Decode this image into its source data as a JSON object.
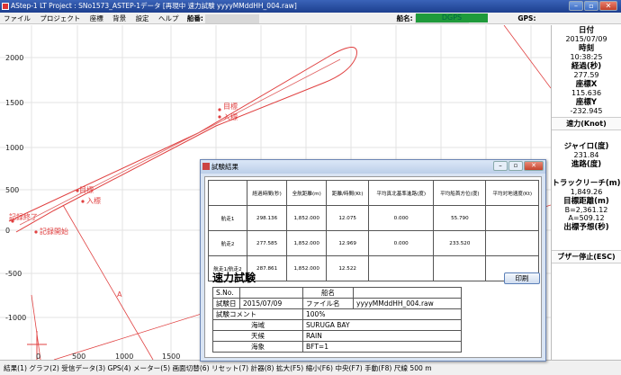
{
  "window": {
    "title": "AStep-1 LT  Project : SNo1573_ASTEP-1データ  [再現中 速力試験 yyyyMMddHH_004.raw]",
    "controls": [
      "–",
      "▫",
      "✕"
    ]
  },
  "menubar": {
    "items": [
      "ファイル",
      "プロジェクト",
      "座標",
      "背景",
      "設定",
      "ヘルプ"
    ],
    "hull_label": "船番:",
    "ship_label": "船名:",
    "gps_label": "GPS:",
    "gps_value": "DGPS"
  },
  "plot": {
    "y_ticks": [
      "2000",
      "1500",
      "1000",
      "500",
      "0",
      "-500",
      "-1000"
    ],
    "x_ticks": [
      "0",
      "500",
      "1000",
      "1500"
    ],
    "markers": {
      "target_top_1": "目標",
      "target_top_2": "入標",
      "target_mid_1": "目標",
      "target_mid_2": "入標",
      "record_end": "記録終了",
      "record_start": "記録開始",
      "point_a": "A"
    }
  },
  "sidepanel": {
    "date_label": "日付",
    "date_value": "2015/07/09",
    "time_label": "時刻",
    "time_value": "10:38:25",
    "elapsed_label": "経過(秒)",
    "elapsed_value": "277.59",
    "x_label": "座標X",
    "x_value": "115.636",
    "y_label": "座標Y",
    "y_value": "-232.945",
    "speed_label": "速力(Knot)",
    "gyro_label": "ジャイロ(度)",
    "gyro_value": "231.84",
    "course_label": "進路(度)",
    "track_label": "トラックリーチ(m)",
    "track_value": "1,849.26",
    "target_label": "目標距離(m)",
    "target_b": "B=2,361.12",
    "target_a": "A=509.12",
    "forecast_label": "出標予想(秒)",
    "buzzer_label": "ブザー停止(ESC)"
  },
  "statusbar": {
    "text": "結果(1) グラフ(2) 受信データ(3) GPS(4) メーター(5) 画面切替(6) リセット(7) 計器(8)  拡大(F5) 縮小(F6) 中央(F7) 手動(F8) 尺線    500    m"
  },
  "dialog": {
    "title": "試験結果",
    "table": {
      "headers": [
        "",
        "経過時間(秒)",
        "全航距離(m)",
        "距離/時間(Kt)",
        "平均真北基準進路(度)",
        "平均船首方位(度)",
        "平均対地速度(Kt)"
      ],
      "rows": [
        [
          "航走1",
          "298.136",
          "1,852.000",
          "12.075",
          "0.000",
          "55.790",
          ""
        ],
        [
          "航走2",
          "277.585",
          "1,852.000",
          "12.969",
          "0.000",
          "233.520",
          ""
        ],
        [
          "航走1/航走2",
          "287.861",
          "1,852.000",
          "12.522",
          "",
          "",
          ""
        ]
      ]
    },
    "heading": "速力試験",
    "print_label": "印刷",
    "info": {
      "sno_label": "S.No.",
      "sno_value": "",
      "shipname_label": "船名",
      "shipname_value": "",
      "date_label": "試験日",
      "date_value": "2015/07/09",
      "file_label": "ファイル名",
      "file_value": "yyyyMMddHH_004.raw",
      "comment_label": "試験コメント",
      "comment_value": "100%",
      "area_label": "海域",
      "area_value": "SURUGA BAY",
      "weather_label": "天候",
      "weather_value": "RAIN",
      "sea_label": "海象",
      "sea_value": "BFT=1"
    }
  }
}
